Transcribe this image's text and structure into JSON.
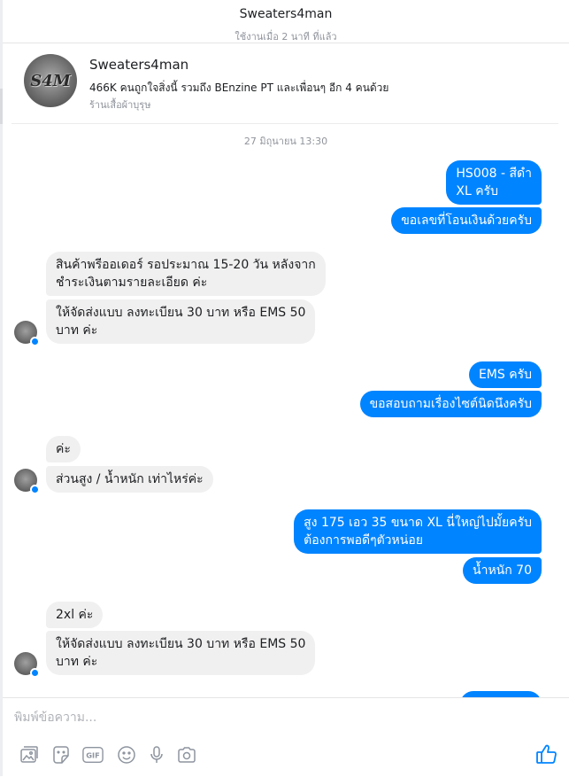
{
  "header": {
    "title": "Sweaters4man",
    "status": "ใช้งานเมื่อ 2 นาที ที่แล้ว"
  },
  "profile": {
    "avatar_text": "S4M",
    "name": "Sweaters4man",
    "likes": "466K คนถูกใจสิ่งนี้ รวมถึง BEnzine PT และเพื่อนๆ อีก 4 คนด้วย",
    "category": "ร้านเสื้อผ้าบุรุษ"
  },
  "conversation": {
    "timestamp": "27 มิถุนายน 13:30",
    "messages": [
      {
        "from": "me",
        "lines": [
          "HS008 - สีดำ",
          "XL ครับ"
        ]
      },
      {
        "from": "me",
        "lines": [
          "ขอเลขที่โอนเงินด้วยครับ"
        ]
      },
      {
        "from": "page",
        "lines": [
          "สินค้าพรีออเดอร์ รอประมาณ 15-20 วัน หลังจาก",
          "ชำระเงินตามรายละเอียด ค่ะ"
        ]
      },
      {
        "from": "page",
        "lines": [
          "ให้จัดส่งแบบ ลงทะเบียน 30 บาท หรือ EMS 50",
          "บาท ค่ะ"
        ]
      },
      {
        "from": "me",
        "lines": [
          "EMS ครับ"
        ]
      },
      {
        "from": "me",
        "lines": [
          "ขอสอบถามเรื่องไซต์นิดนึงครับ"
        ]
      },
      {
        "from": "page",
        "lines": [
          "ค่ะ"
        ]
      },
      {
        "from": "page",
        "lines": [
          "ส่วนสูง / น้ำหนัก เท่าไหร่ค่ะ"
        ]
      },
      {
        "from": "me",
        "lines": [
          "สูง 175 เอว 35 ขนาด XL นี่ใหญ่ไปมั้ยครับ",
          "ต้องการพอดีๆตัวหน่อย"
        ]
      },
      {
        "from": "me",
        "lines": [
          "น้ำหนัก 70"
        ]
      },
      {
        "from": "page",
        "lines": [
          "2xl ค่ะ"
        ]
      },
      {
        "from": "page",
        "lines": [
          "ให้จัดส่งแบบ ลงทะเบียน 30 บาท หรือ EMS 50",
          "บาท ค่ะ"
        ]
      }
    ]
  },
  "composer": {
    "placeholder": "พิมพ์ข้อความ...",
    "tools": [
      "photo-icon",
      "sticker-icon",
      "gif-icon",
      "emoji-icon",
      "microphone-icon",
      "camera-icon"
    ],
    "send_icon": "thumbs-up-icon"
  },
  "colors": {
    "sent_bubble": "#0084ff",
    "received_bubble": "#f1f0f0",
    "secondary_text": "#90949c"
  }
}
